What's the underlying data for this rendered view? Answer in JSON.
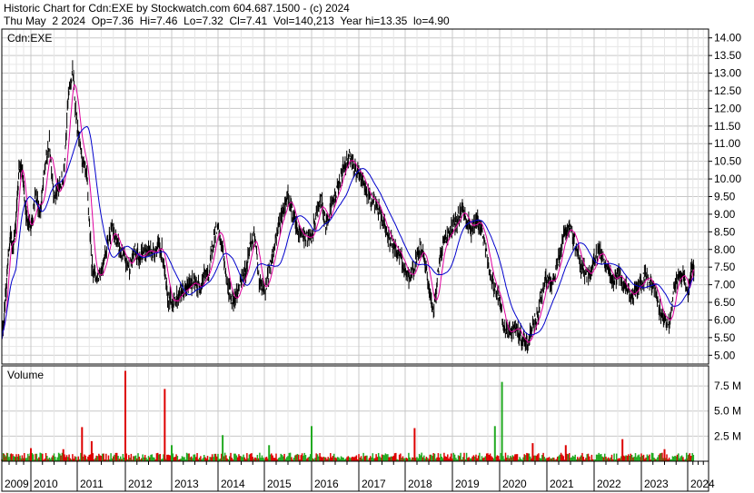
{
  "header": {
    "line1": "Historic Chart for Cdn:EXE by Stockwatch.com 604.687.1500 - (c) 2024",
    "line2": "Thu May  2 2024  Op=7.36  Hi=7.46  Lo=7.32  Cl=7.41  Vol=140,213  Year hi=13.35  lo=4.90"
  },
  "colors": {
    "price_bars": "#000000",
    "ma_short": "#e0009f",
    "ma_long": "#0000cc",
    "volume_up": "#22aa22",
    "volume_down": "#dd0000",
    "grid": "#c8c8c8"
  },
  "chart_data": [
    {
      "type": "line",
      "label": "Cdn:EXE",
      "title": "",
      "grid": true,
      "y_axis_position": "right",
      "ylim": [
        4.75,
        14.25
      ],
      "yticks": [
        "14.00",
        "13.50",
        "13.00",
        "12.50",
        "12.00",
        "11.50",
        "11.00",
        "10.50",
        "10.00",
        "9.50",
        "9.00",
        "8.50",
        "8.00",
        "7.50",
        "7.00",
        "6.50",
        "6.00",
        "5.50",
        "5.00"
      ],
      "x_year_labels": [
        "2009",
        "2010",
        "2011",
        "2012",
        "2013",
        "2014",
        "2015",
        "2016",
        "2017",
        "2018",
        "2019",
        "2020",
        "2021",
        "2022",
        "2023",
        "2024"
      ],
      "series": [
        {
          "style": "hlc-bars",
          "x": [
            2009.0,
            2009.1,
            2009.2,
            2009.3,
            2009.4,
            2009.5,
            2009.6,
            2009.7,
            2009.8,
            2009.9,
            2010.0,
            2010.1,
            2010.2,
            2010.3,
            2010.4,
            2010.5,
            2010.6,
            2010.7,
            2010.8,
            2010.9,
            2011.0,
            2011.1,
            2011.2,
            2011.3,
            2011.4,
            2011.5,
            2011.6,
            2011.7,
            2011.8,
            2011.9,
            2012.0,
            2012.1,
            2012.2,
            2012.3,
            2012.4,
            2012.5,
            2012.6,
            2012.7,
            2012.8,
            2012.9,
            2013.0,
            2013.1,
            2013.2,
            2013.3,
            2013.4,
            2013.5,
            2013.6,
            2013.7,
            2013.8,
            2013.9,
            2014.0,
            2014.1,
            2014.2,
            2014.3,
            2014.4,
            2014.5,
            2014.6,
            2014.7,
            2014.8,
            2014.9,
            2015.0,
            2015.1,
            2015.2,
            2015.3,
            2015.4,
            2015.5,
            2015.6,
            2015.7,
            2015.8,
            2015.9,
            2016.0,
            2016.1,
            2016.2,
            2016.3,
            2016.4,
            2016.5,
            2016.6,
            2016.7,
            2016.8,
            2016.9,
            2017.0,
            2017.1,
            2017.2,
            2017.3,
            2017.4,
            2017.5,
            2017.6,
            2017.7,
            2017.8,
            2017.9,
            2018.0,
            2018.1,
            2018.2,
            2018.3,
            2018.4,
            2018.5,
            2018.6,
            2018.7,
            2018.8,
            2018.9,
            2019.0,
            2019.1,
            2019.2,
            2019.3,
            2019.4,
            2019.5,
            2019.6,
            2019.7,
            2019.8,
            2019.9,
            2020.0,
            2020.1,
            2020.2,
            2020.3,
            2020.4,
            2020.5,
            2020.6,
            2020.7,
            2020.8,
            2020.9,
            2021.0,
            2021.1,
            2021.2,
            2021.3,
            2021.4,
            2021.5,
            2021.6,
            2021.7,
            2021.8,
            2021.9,
            2022.0,
            2022.1,
            2022.2,
            2022.3,
            2022.4,
            2022.5,
            2022.6,
            2022.7,
            2022.8,
            2022.9,
            2023.0,
            2023.1,
            2023.2,
            2023.3,
            2023.4,
            2023.5,
            2023.6,
            2023.7,
            2023.8,
            2023.9,
            2024.0,
            2024.1,
            2024.2,
            2024.3
          ],
          "close": [
            5.6,
            6.2,
            7.6,
            8.4,
            8.0,
            9.0,
            10.4,
            10.2,
            9.2,
            8.8,
            8.6,
            9.6,
            9.0,
            10.3,
            11.0,
            9.5,
            9.7,
            10.0,
            12.2,
            13.1,
            11.4,
            10.6,
            10.0,
            7.6,
            7.2,
            7.4,
            8.0,
            8.6,
            8.3,
            7.9,
            7.7,
            7.5,
            8.0,
            7.8,
            7.9,
            8.0,
            7.9,
            8.1,
            7.9,
            6.7,
            6.5,
            6.6,
            6.8,
            6.8,
            7.1,
            7.0,
            6.9,
            7.3,
            7.3,
            8.3,
            8.6,
            8.0,
            7.0,
            6.6,
            6.7,
            7.1,
            7.4,
            8.2,
            8.3,
            7.0,
            6.8,
            7.4,
            8.0,
            8.7,
            9.1,
            9.6,
            9.0,
            8.5,
            8.4,
            8.3,
            8.3,
            9.0,
            9.4,
            8.7,
            9.2,
            9.5,
            10.0,
            10.4,
            10.7,
            10.3,
            10.1,
            9.9,
            9.5,
            9.4,
            9.2,
            8.8,
            8.5,
            8.2,
            8.0,
            7.8,
            7.3,
            7.2,
            7.5,
            8.0,
            7.9,
            6.9,
            6.2,
            7.4,
            8.2,
            8.4,
            8.6,
            8.8,
            9.2,
            8.8,
            8.6,
            8.8,
            8.7,
            8.0,
            7.3,
            6.9,
            6.5,
            5.7,
            5.6,
            5.8,
            5.6,
            5.4,
            5.3,
            5.9,
            6.1,
            6.8,
            7.2,
            6.9,
            7.5,
            8.0,
            8.6,
            8.5,
            8.2,
            7.6,
            7.4,
            7.2,
            7.7,
            8.0,
            7.6,
            7.4,
            7.1,
            7.3,
            7.0,
            6.8,
            6.7,
            6.9,
            7.1,
            7.3,
            7.0,
            6.9,
            6.2,
            6.1,
            5.9,
            6.9,
            7.2,
            7.3,
            6.8,
            7.0,
            7.5,
            7.4
          ]
        },
        {
          "name": "",
          "style": "moving-average",
          "color": "#e0009f"
        },
        {
          "name": "",
          "style": "moving-average",
          "color": "#0000cc"
        }
      ]
    },
    {
      "type": "bar",
      "label": "Volume",
      "title": "",
      "grid": true,
      "y_axis_position": "right",
      "ylim": [
        0,
        9.5
      ],
      "y_unit": "M",
      "yticks": [
        "7.5 M",
        "5.0 M",
        "2.5 M"
      ],
      "spikes": [
        {
          "x": 2010.0,
          "value": 1.3,
          "direction": "down"
        },
        {
          "x": 2010.7,
          "value": 1.2,
          "direction": "down"
        },
        {
          "x": 2011.1,
          "value": 3.4,
          "direction": "down"
        },
        {
          "x": 2011.3,
          "value": 2.0,
          "direction": "down"
        },
        {
          "x": 2012.0,
          "value": 9.0,
          "direction": "down"
        },
        {
          "x": 2012.85,
          "value": 7.2,
          "direction": "down"
        },
        {
          "x": 2013.0,
          "value": 1.6,
          "direction": "up"
        },
        {
          "x": 2014.1,
          "value": 2.6,
          "direction": "up"
        },
        {
          "x": 2015.1,
          "value": 1.6,
          "direction": "up"
        },
        {
          "x": 2016.0,
          "value": 3.5,
          "direction": "up"
        },
        {
          "x": 2018.2,
          "value": 3.3,
          "direction": "down"
        },
        {
          "x": 2019.9,
          "value": 3.5,
          "direction": "up"
        },
        {
          "x": 2020.05,
          "value": 7.9,
          "direction": "up"
        },
        {
          "x": 2020.7,
          "value": 1.8,
          "direction": "down"
        },
        {
          "x": 2021.4,
          "value": 1.6,
          "direction": "down"
        },
        {
          "x": 2022.6,
          "value": 2.2,
          "direction": "down"
        },
        {
          "x": 2023.5,
          "value": 1.2,
          "direction": "down"
        }
      ],
      "typical_volume": 0.45
    }
  ]
}
